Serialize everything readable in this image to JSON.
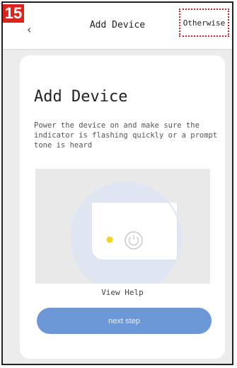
{
  "step_badge": "15",
  "header": {
    "back_icon": "chevron-left-icon",
    "title": "Add Device",
    "otherwise_label": "Otherwise"
  },
  "card": {
    "title": "Add Device",
    "description": "Power the device on and make sure the indicator is flashing quickly or a prompt tone is heard",
    "help_label": "View Help",
    "next_label": "next step"
  },
  "colors": {
    "badge": "#e0231a",
    "highlight_border": "#d11f1f",
    "button": "#6c98d8",
    "indicator_dot": "#f3d324"
  }
}
